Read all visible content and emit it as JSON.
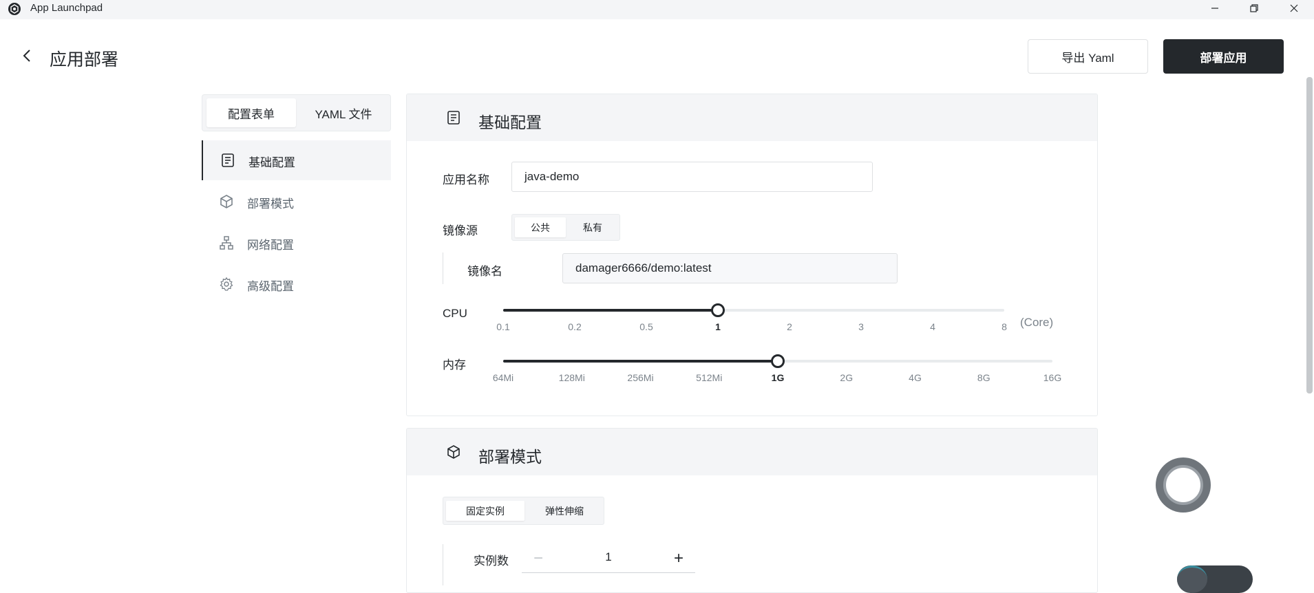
{
  "window": {
    "title": "App Launchpad"
  },
  "header": {
    "title": "应用部署",
    "export_label": "导出 Yaml",
    "deploy_label": "部署应用"
  },
  "tabs": [
    {
      "label": "配置表单",
      "active": true
    },
    {
      "label": "YAML 文件",
      "active": false
    }
  ],
  "nav": [
    {
      "label": "基础配置",
      "icon": "document-icon",
      "active": true
    },
    {
      "label": "部署模式",
      "icon": "cube-icon",
      "active": false
    },
    {
      "label": "网络配置",
      "icon": "network-icon",
      "active": false
    },
    {
      "label": "高级配置",
      "icon": "gear-icon",
      "active": false
    }
  ],
  "basic": {
    "title": "基础配置",
    "app_name_label": "应用名称",
    "app_name_value": "java-demo",
    "image_source_label": "镜像源",
    "image_source_options": [
      "公共",
      "私有"
    ],
    "image_source_selected": "公共",
    "image_name_label": "镜像名",
    "image_name_value": "damager6666/demo:latest",
    "cpu": {
      "label": "CPU",
      "ticks": [
        "0.1",
        "0.2",
        "0.5",
        "1",
        "2",
        "3",
        "4",
        "8"
      ],
      "selected": "1",
      "unit": "(Core)"
    },
    "memory": {
      "label": "内存",
      "ticks": [
        "64Mi",
        "128Mi",
        "256Mi",
        "512Mi",
        "1G",
        "2G",
        "4G",
        "8G",
        "16G"
      ],
      "selected": "1G"
    }
  },
  "mode": {
    "title": "部署模式",
    "options": [
      "固定实例",
      "弹性伸缩"
    ],
    "selected": "固定实例",
    "instances_label": "实例数",
    "instances_value": "1",
    "minus": "−",
    "plus": "+"
  },
  "colors": {
    "primary": "#24282c",
    "panel_bg": "#f4f5f7",
    "border": "#e8ebed"
  }
}
